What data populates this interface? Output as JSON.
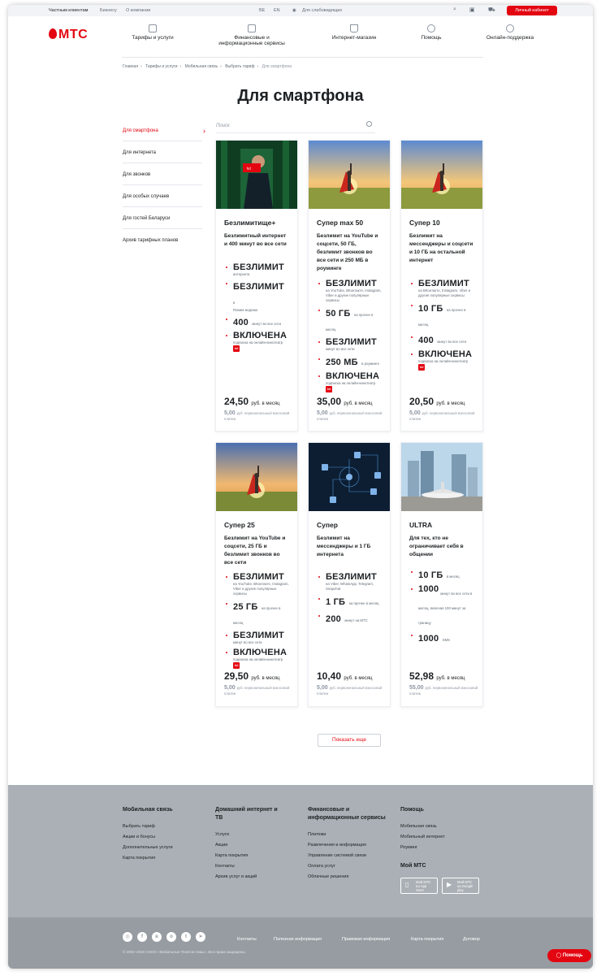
{
  "topbar": {
    "private": "Частным клиентам",
    "business": "Бизнесу",
    "about": "О компании",
    "lang_be": "BE",
    "lang_en": "EN",
    "accessibility": "Для слабовидящих",
    "cabinet": "Личный кабинет"
  },
  "logo": "МТС",
  "nav": [
    "Тарифы и услуги",
    "Финансовые и информационные сервисы",
    "Интернет-магазин",
    "Помощь",
    "Онлайн-поддержка"
  ],
  "breadcrumbs": [
    "Главная",
    "Тарифы и услуги",
    "Мобильная связь",
    "Выбрать тариф",
    "Для смартфона"
  ],
  "title": "Для смартфона",
  "sidebar": [
    "Для смартфона",
    "Для интернета",
    "Для звонков",
    "Для особых случаев",
    "Для гостей Беларуси",
    "Архив тарифных планов"
  ],
  "search_placeholder": "Поиск",
  "cards": [
    {
      "title": "Безлимитище+",
      "desc": "Безлимитный интернет и 400 минут во все сети",
      "features": [
        {
          "b": "БЕЗЛИМИТ",
          "s": "интернета"
        },
        {
          "b": "БЕЗЛИМИТ",
          "s": "Режим модема",
          "inline": "в"
        },
        {
          "b": "400",
          "inline": "минут во все сети"
        },
        {
          "b": "ВКЛЮЧЕНА",
          "s": "подписка на онлайн-кинотеатр",
          "ivi": "ivi"
        }
      ],
      "price": "24,50",
      "price_unit": "руб. в месяц",
      "init": "5,00",
      "init_unit": "руб. первоначальный взносовой платеж"
    },
    {
      "title": "Супер max 50",
      "desc": "Безлимит на YouTube и соцсети, 50 ГБ, безлимит звонков во все сети и 250 МБ в роуминге",
      "features": [
        {
          "b": "БЕЗЛИМИТ",
          "s": "на YouTube, ВКонтакте, Instagram, Viber и другие популярные сервисы"
        },
        {
          "b": "50 ГБ",
          "inline": "на прочее в месяц"
        },
        {
          "b": "БЕЗЛИМИТ",
          "s": "минут во все сети"
        },
        {
          "b": "250 МБ",
          "inline": "в роуминге"
        },
        {
          "b": "ВКЛЮЧЕНА",
          "s": "подписка на онлайн-кинотеатр",
          "ivi": "ivi"
        }
      ],
      "price": "35,00",
      "price_unit": "руб. в месяц",
      "init": "5,00",
      "init_unit": "руб. первоначальный взносовой платеж"
    },
    {
      "title": "Супер 10",
      "desc": "Безлимит на мессенджеры и соцсети и 10 ГБ на остальной интернет",
      "features": [
        {
          "b": "БЕЗЛИМИТ",
          "s": "на ВКонтакте, Instagram, Viber и другие популярные сервисы"
        },
        {
          "b": "10 ГБ",
          "inline": "на прочее в месяц"
        },
        {
          "b": "400",
          "inline": "минут во все сети"
        },
        {
          "b": "ВКЛЮЧЕНА",
          "s": "подписка на онлайн-кинотеатр",
          "ivi": "ivi"
        }
      ],
      "price": "20,50",
      "price_unit": "руб. в месяц",
      "init": "5,00",
      "init_unit": "руб. первоначальный взносовой платеж"
    },
    {
      "title": "Супер 25",
      "desc": "Безлимит на YouTube и соцсети, 25 ГБ и безлимит звонков во все сети",
      "features": [
        {
          "b": "БЕЗЛИМИТ",
          "s": "на YouTube, ВКонтакте, Instagram, Viber и другие популярные сервисы"
        },
        {
          "b": "25 ГБ",
          "inline": "на прочее в месяц"
        },
        {
          "b": "БЕЗЛИМИТ",
          "s": "минут во все сети"
        },
        {
          "b": "ВКЛЮЧЕНА",
          "s": "подписка на онлайн-кинотеатр",
          "ivi": "ivi"
        }
      ],
      "price": "29,50",
      "price_unit": "руб. в месяц",
      "init": "5,00",
      "init_unit": "руб. первоначальный взносовой платеж"
    },
    {
      "title": "Супер",
      "desc": "Безлимит на мессенджеры и 1 ГБ интернета",
      "features": [
        {
          "b": "БЕЗЛИМИТ",
          "s": "на Viber, WhatsApp, Telegram, Snapchat"
        },
        {
          "b": "1 ГБ",
          "inline": "на прочее в месяц"
        },
        {
          "b": "200",
          "inline": "минут на МТС"
        }
      ],
      "price": "10,40",
      "price_unit": "руб. в месяц",
      "init": "5,00",
      "init_unit": "руб. первоначальный взносовой платеж"
    },
    {
      "title": "ULTRA",
      "desc": "Для тех, кто не ограничивает себя в общении",
      "features": [
        {
          "b": "10 ГБ",
          "inline": "в месяц"
        },
        {
          "b": "1000",
          "inline": "минут во все сети в месяц, включая 100 минут за границу"
        },
        {
          "b": "1000",
          "inline": "SMS"
        }
      ],
      "price": "52,98",
      "price_unit": "руб. в месяц",
      "init": "55,00",
      "init_unit": "руб. первоначальный взносовой платеж"
    }
  ],
  "show_more": "Показать еще",
  "footer": {
    "col1": {
      "title": "Мобильная связь",
      "links": [
        "Выбрать тариф",
        "Акции и бонусы",
        "Дополнительные услуги",
        "Карта покрытия"
      ]
    },
    "col2": {
      "title": "Домашний интернет и ТВ",
      "links": [
        "Услуги",
        "Акции",
        "Карта покрытия",
        "Контакты",
        "Архив услуг и акций"
      ]
    },
    "col3": {
      "title": "Финансовые и информационные сервисы",
      "links": [
        "Платежи",
        "Развлечения и информация",
        "Управление системой связи",
        "Оплата услуг",
        "Облачные решения"
      ]
    },
    "col4": {
      "title": "Помощь",
      "links": [
        "Мобильная связь",
        "Мобильный интернет",
        "Роуминг"
      ]
    },
    "mymts": "Мой МТС",
    "appstore": "Мой МТС на App Store",
    "googleplay": "Мой МТС на Google play",
    "links": [
      "Контакты",
      "Полезная информация",
      "Правовая информация",
      "Карта покрытия",
      "Договор"
    ],
    "copyright": "© 2002–2020 СООО «Мобильные ТелеСистемы». Все права защищены.",
    "help": "Помощь"
  },
  "colors": {
    "accent": "#e30611",
    "footer": "#aab0b5"
  }
}
